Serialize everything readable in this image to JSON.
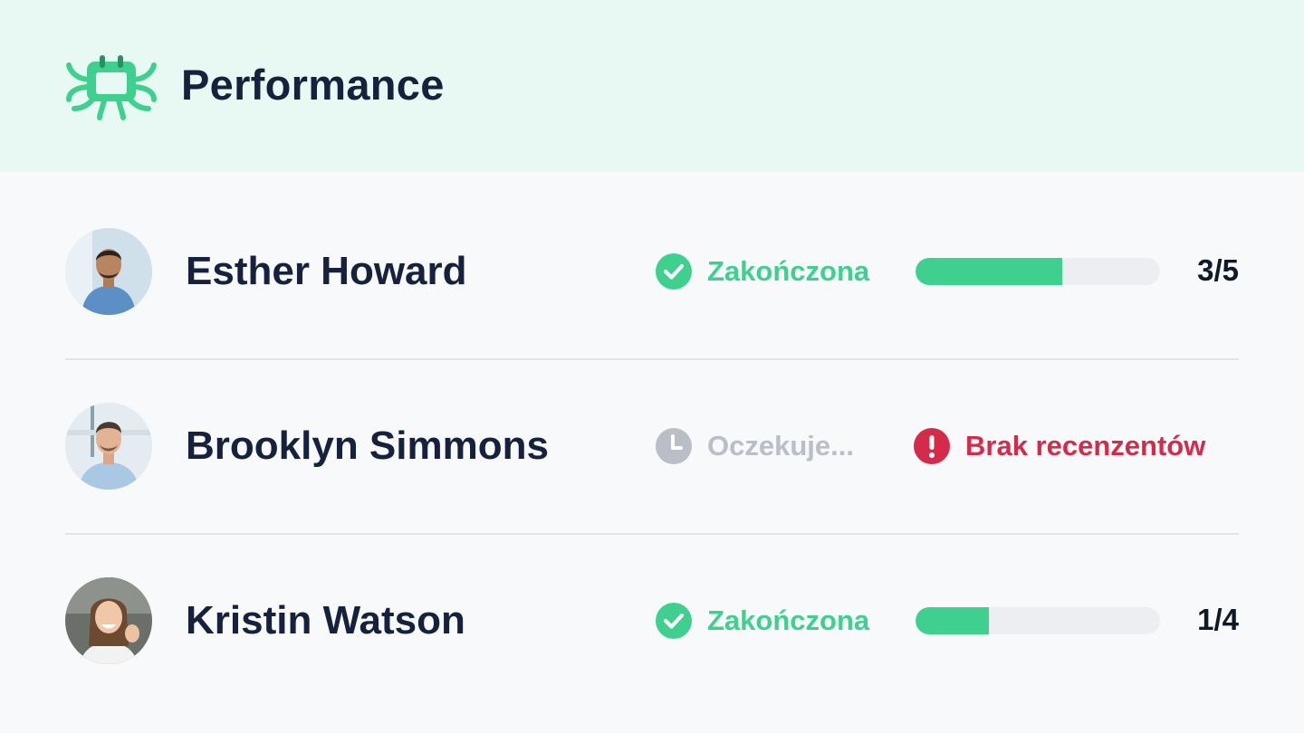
{
  "header": {
    "title": "Performance",
    "logo_icon": "octopus-calendar-logo",
    "background": "#e8f8f2"
  },
  "colors": {
    "accent_green": "#3fd08f",
    "pending_gray": "#b9bec7",
    "alert_red": "#d42b4a",
    "text_navy": "#16213e"
  },
  "rows": [
    {
      "name": "Esther Howard",
      "status": {
        "label": "Zakończona",
        "icon": "check-circle-icon",
        "kind": "done"
      },
      "progress": {
        "completed": 3,
        "total": 5,
        "fraction": 0.6,
        "label": "3/5"
      }
    },
    {
      "name": "Brooklyn Simmons",
      "status": {
        "label": "Oczekuje...",
        "icon": "clock-icon",
        "kind": "pending"
      },
      "alert": {
        "label": "Brak recenzentów",
        "icon": "exclamation-circle-icon"
      }
    },
    {
      "name": "Kristin Watson",
      "status": {
        "label": "Zakończona",
        "icon": "check-circle-icon",
        "kind": "done"
      },
      "progress": {
        "completed": 1,
        "total": 4,
        "fraction": 0.3,
        "label": "1/4"
      }
    }
  ]
}
